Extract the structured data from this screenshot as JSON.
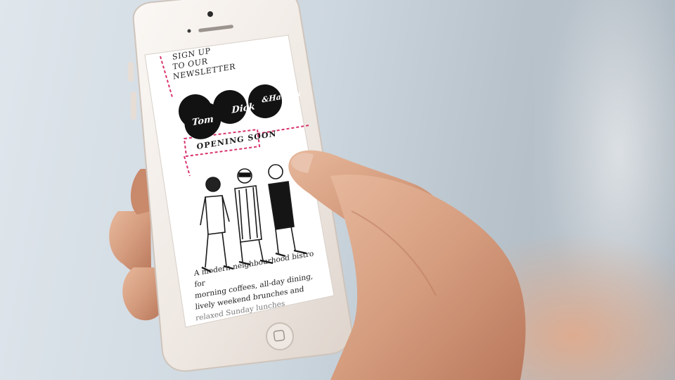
{
  "screen": {
    "newsletter_lines": [
      "SIGN UP",
      "TO OUR",
      "NEWSLETTER"
    ],
    "logo": {
      "circles": [
        "Tom",
        "Dick",
        "&Harry's"
      ]
    },
    "opening_label": "OPENING SOON",
    "description_lines": [
      "A modern neighbourhood bistro for",
      "morning coffees, all-day dining,",
      "lively weekend brunches and",
      "relaxed Sunday lunches"
    ]
  },
  "colors": {
    "accent_pink": "#d9336f",
    "phone_body": "#f1ece8",
    "skin": "#d8a184",
    "ink": "#121212"
  }
}
